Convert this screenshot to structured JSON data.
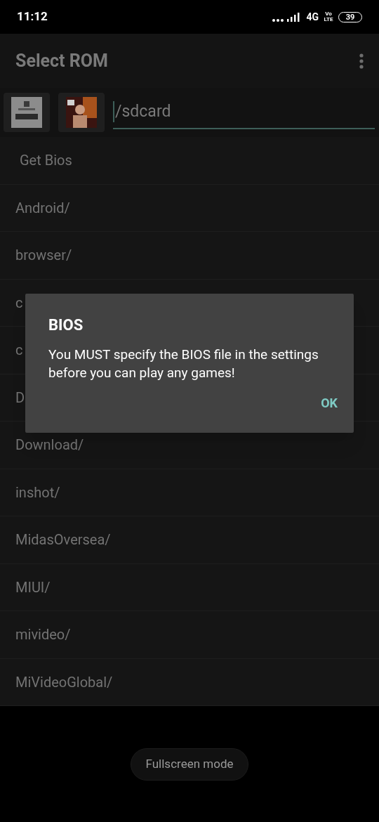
{
  "status_bar": {
    "time": "11:12",
    "network": "4G",
    "volte": "Vo LTE",
    "battery": "39"
  },
  "app_bar": {
    "title": "Select ROM"
  },
  "path_field": {
    "value": "/sdcard"
  },
  "list": [
    {
      "kind": "action",
      "label": "Get Bios"
    },
    {
      "kind": "folder",
      "label": "Android/"
    },
    {
      "kind": "folder",
      "label": "browser/"
    },
    {
      "kind": "folder",
      "label": "c"
    },
    {
      "kind": "folder",
      "label": "c"
    },
    {
      "kind": "folder",
      "label": "D"
    },
    {
      "kind": "folder",
      "label": "Download/"
    },
    {
      "kind": "folder",
      "label": "inshot/"
    },
    {
      "kind": "folder",
      "label": "MidasOversea/"
    },
    {
      "kind": "folder",
      "label": "MIUI/"
    },
    {
      "kind": "folder",
      "label": "mivideo/"
    },
    {
      "kind": "folder",
      "label": "MiVideoGlobal/"
    }
  ],
  "dialog": {
    "title": "BIOS",
    "message": "You MUST specify the BIOS file in the settings before you can play any games!",
    "button": "OK"
  },
  "fullscreen_button": "Fullscreen mode"
}
